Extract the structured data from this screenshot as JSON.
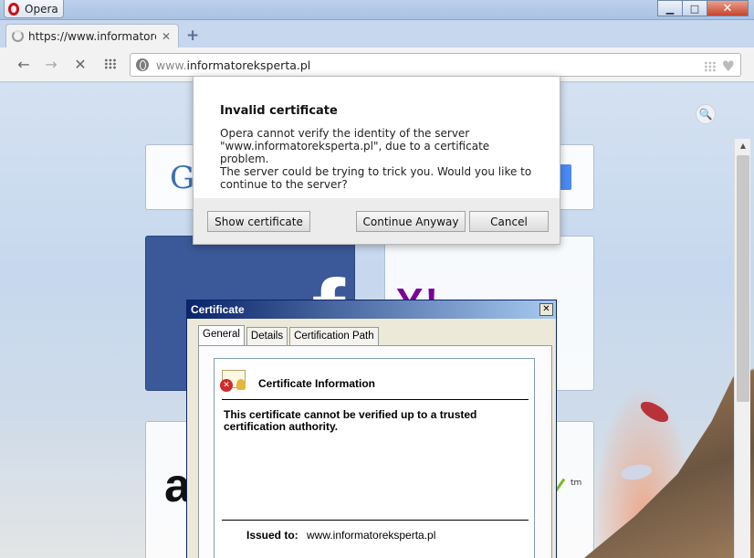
{
  "window": {
    "app_title": "Opera",
    "min": "▁",
    "max": "□",
    "close": "✕"
  },
  "tab": {
    "title": "https://www.informatoreksperta.pl",
    "close": "✕",
    "new_tab": "+"
  },
  "toolbar": {
    "back": "←",
    "forward": "→",
    "stop": "✕"
  },
  "address": {
    "prefix": "www.",
    "domain": "informatoreksperta.pl"
  },
  "page": {
    "search_icon": "🔍",
    "dials": {
      "google": "G",
      "facebook": "f",
      "yahoo": "Y!",
      "amazon": "a",
      "tm": "tm"
    }
  },
  "popup": {
    "title": "Invalid certificate",
    "message": "Opera cannot verify the identity of the server\n\"www.informatoreksperta.pl\", due to a certificate problem.\nThe server could be trying to trick you. Would you like to\ncontinue to the server?",
    "show_certificate": "Show certificate",
    "continue_anyway": "Continue Anyway",
    "cancel": "Cancel"
  },
  "cert_dialog": {
    "title": "Certificate",
    "close": "✕",
    "tabs": [
      "General",
      "Details",
      "Certification Path"
    ],
    "info_title": "Certificate Information",
    "warning": "This certificate cannot be verified up to a trusted certification authority.",
    "issued_to_label": "Issued to:",
    "issued_to_value": "www.informatoreksperta.pl"
  },
  "colors": {
    "facebook": "#3b5998",
    "yahoo": "#7b0099",
    "opera_red": "#cc0f16"
  }
}
